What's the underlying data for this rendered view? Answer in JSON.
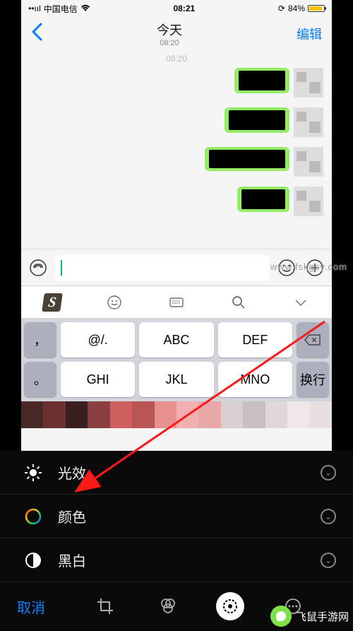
{
  "status": {
    "carrier": "中国电信",
    "time": "08:21",
    "battery_percent": "84%"
  },
  "nav": {
    "title": "今天",
    "subtitle": "08:20",
    "edit": "编辑"
  },
  "chat": {
    "timestamp": "08:20"
  },
  "keyboard": {
    "keys": {
      "at": "@/.",
      "abc": "ABC",
      "def": "DEF",
      "ghi": "GHI",
      "jkl": "JKL",
      "mno": "MNO",
      "comma": "，",
      "period": "。",
      "return": "换行"
    }
  },
  "edit_panel": {
    "light": "光效",
    "color": "颜色",
    "bw": "黑白",
    "cancel": "取消"
  },
  "watermark_url": "www.fskgsy.com",
  "watermark_brand": "飞鼠手游网"
}
